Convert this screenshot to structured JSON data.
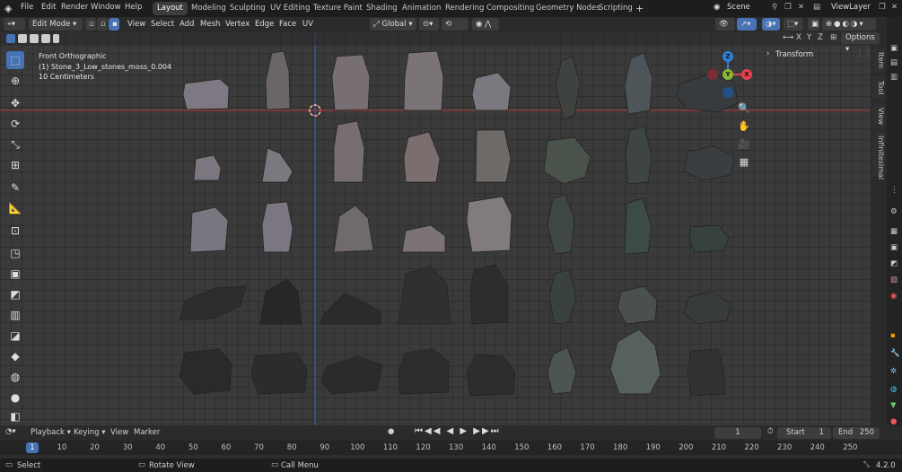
{
  "menu": [
    "File",
    "Edit",
    "Render",
    "Window",
    "Help"
  ],
  "workspaces": [
    "Layout",
    "Modeling",
    "Sculpting",
    "UV Editing",
    "Texture Paint",
    "Shading",
    "Animation",
    "Rendering",
    "Compositing",
    "Geometry Nodes",
    "Scripting"
  ],
  "active_workspace": "Layout",
  "add_tab_symbol": "+",
  "scene": "Scene",
  "view_layer": "ViewLayer",
  "header": {
    "mode": "Edit Mode",
    "menus": [
      "View",
      "Select",
      "Add",
      "Mesh",
      "Vertex",
      "Edge",
      "Face",
      "UV"
    ],
    "orientation": "Global",
    "axes": [
      "X",
      "Y",
      "Z"
    ],
    "options": "Options"
  },
  "viewport": {
    "view_name": "Front Orthographic",
    "object_name": "(1) Stone_3_Low_stones_moss_0.004",
    "scale": "10 Centimeters"
  },
  "gizmo": {
    "z": "Z",
    "y": "Y",
    "x": "X"
  },
  "n_panel": {
    "transform": "Transform",
    "tabs": [
      "Item",
      "Tool",
      "View",
      "Infinitesimal"
    ]
  },
  "timeline": {
    "menus": [
      "Playback",
      "Keying",
      "View",
      "Marker"
    ],
    "current_frame": "1",
    "start_label": "Start",
    "start": "1",
    "end_label": "End",
    "end": "250",
    "ticks": [
      "1",
      "10",
      "20",
      "30",
      "40",
      "50",
      "60",
      "70",
      "80",
      "90",
      "100",
      "110",
      "120",
      "130",
      "140",
      "150",
      "160",
      "170",
      "180",
      "190",
      "200",
      "210",
      "220",
      "230",
      "240",
      "250"
    ]
  },
  "status": {
    "select": "Select",
    "rotate": "Rotate View",
    "call_menu": "Call Menu",
    "version": "4.2.0"
  },
  "colors": {
    "active_blue": "#4772b3",
    "x_axis": "#e2424f",
    "y_axis": "#8ab834",
    "z_axis": "#2e7fd6"
  }
}
